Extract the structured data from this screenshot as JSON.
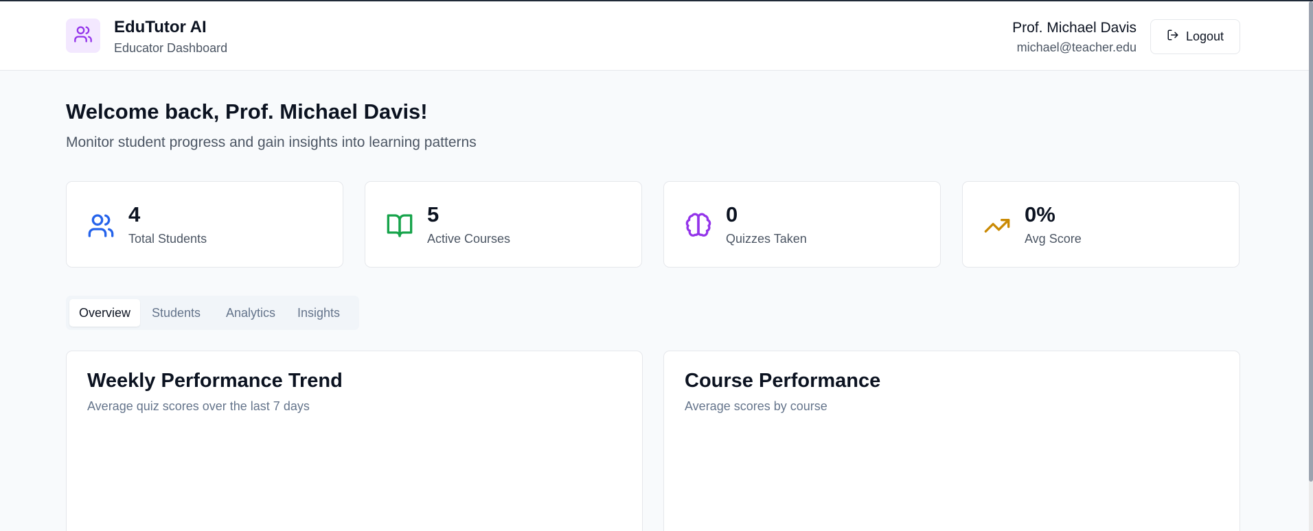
{
  "app": {
    "title": "EduTutor AI",
    "subtitle": "Educator Dashboard",
    "logo_icon": "users-icon",
    "accent_color": "#9333ea"
  },
  "user": {
    "name": "Prof. Michael Davis",
    "email": "michael@teacher.edu",
    "logout_label": "Logout",
    "logout_icon": "logout-icon"
  },
  "welcome": {
    "heading": "Welcome back, Prof. Michael Davis!",
    "subheading": "Monitor student progress and gain insights into learning patterns"
  },
  "stats": [
    {
      "value": "4",
      "label": "Total Students",
      "icon": "users-icon",
      "color": "#2563eb"
    },
    {
      "value": "5",
      "label": "Active Courses",
      "icon": "book-open-icon",
      "color": "#16a34a"
    },
    {
      "value": "0",
      "label": "Quizzes Taken",
      "icon": "brain-icon",
      "color": "#9333ea"
    },
    {
      "value": "0%",
      "label": "Avg Score",
      "icon": "trending-up-icon",
      "color": "#ca8a04"
    }
  ],
  "tabs": [
    {
      "label": "Overview",
      "active": true
    },
    {
      "label": "Students",
      "active": false
    },
    {
      "label": "Analytics",
      "active": false
    },
    {
      "label": "Insights",
      "active": false
    }
  ],
  "panels": [
    {
      "title": "Weekly Performance Trend",
      "subtitle": "Average quiz scores over the last 7 days"
    },
    {
      "title": "Course Performance",
      "subtitle": "Average scores by course"
    }
  ]
}
